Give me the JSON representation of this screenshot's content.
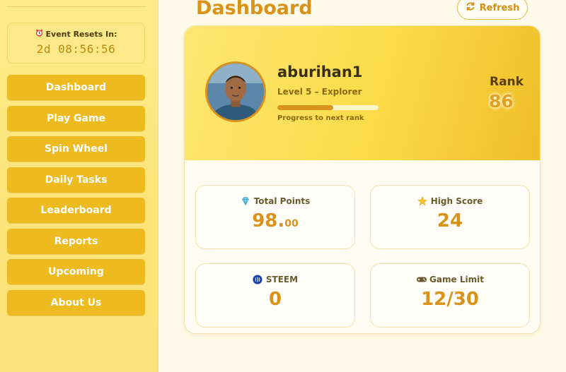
{
  "sidebar": {
    "timer": {
      "title": "Event Resets In:",
      "value": "2d 08:56:56",
      "icon": "alarm-clock-icon"
    },
    "nav_items": [
      {
        "label": "Dashboard"
      },
      {
        "label": "Play Game"
      },
      {
        "label": "Spin Wheel"
      },
      {
        "label": "Daily Tasks"
      },
      {
        "label": "Leaderboard"
      },
      {
        "label": "Reports"
      },
      {
        "label": "Upcoming"
      },
      {
        "label": "About Us"
      }
    ]
  },
  "header": {
    "title": "Dashboard",
    "refresh_label": "Refresh"
  },
  "profile": {
    "username": "aburihan1",
    "level": "Level 5 – Explorer",
    "progress_fraction": 0.55,
    "progress_label": "Progress to next rank",
    "rank_label": "Rank",
    "rank_value": "86"
  },
  "stats": {
    "total_points": {
      "title": "Total Points",
      "value_int": "98.",
      "value_dec": "00",
      "icon": "gem-icon"
    },
    "high_score": {
      "title": "High Score",
      "value": "24",
      "icon": "star-icon"
    },
    "steem": {
      "title": "STEEM",
      "value": "0",
      "icon": "steem-logo-icon"
    },
    "game_limit": {
      "title": "Game Limit",
      "value": "12/30",
      "icon": "gamepad-icon"
    }
  },
  "colors": {
    "accent": "#d9931a",
    "nav_button": "#edba20",
    "value_text": "#d9931a"
  }
}
